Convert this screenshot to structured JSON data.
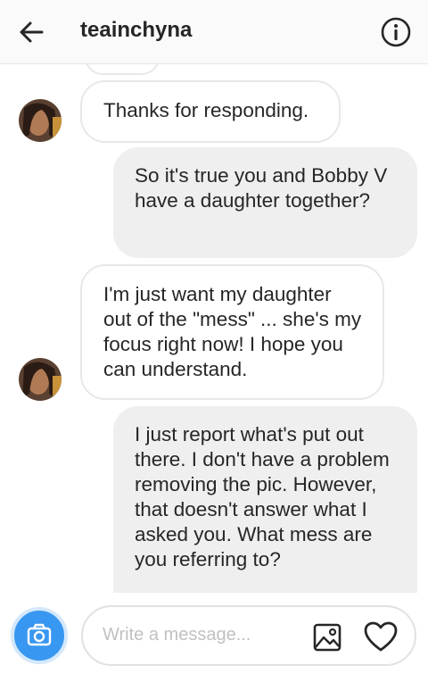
{
  "header": {
    "username": "teainchyna",
    "back_icon": "arrow-left-icon",
    "info_icon": "info-circle-icon"
  },
  "messages": [
    {
      "direction": "incoming",
      "text": "Thanks for responding."
    },
    {
      "direction": "outgoing",
      "text": "So it's true you and Bobby V have a daughter together?"
    },
    {
      "direction": "incoming",
      "text": "I'm just want my daughter out of the \"mess\" ... she's my focus right now! I hope you can understand."
    },
    {
      "direction": "outgoing",
      "text": "I just report what's put out there. I don't have a problem removing the pic. However, that doesn't answer what I asked you. What mess are you referring to?"
    }
  ],
  "composer": {
    "placeholder": "Write a message...",
    "camera_icon": "camera-icon",
    "image_icon": "image-icon",
    "heart_icon": "heart-icon"
  },
  "colors": {
    "accent": "#3897f0",
    "outgoing_bubble": "#efefef",
    "incoming_border": "#e8e8e8"
  }
}
